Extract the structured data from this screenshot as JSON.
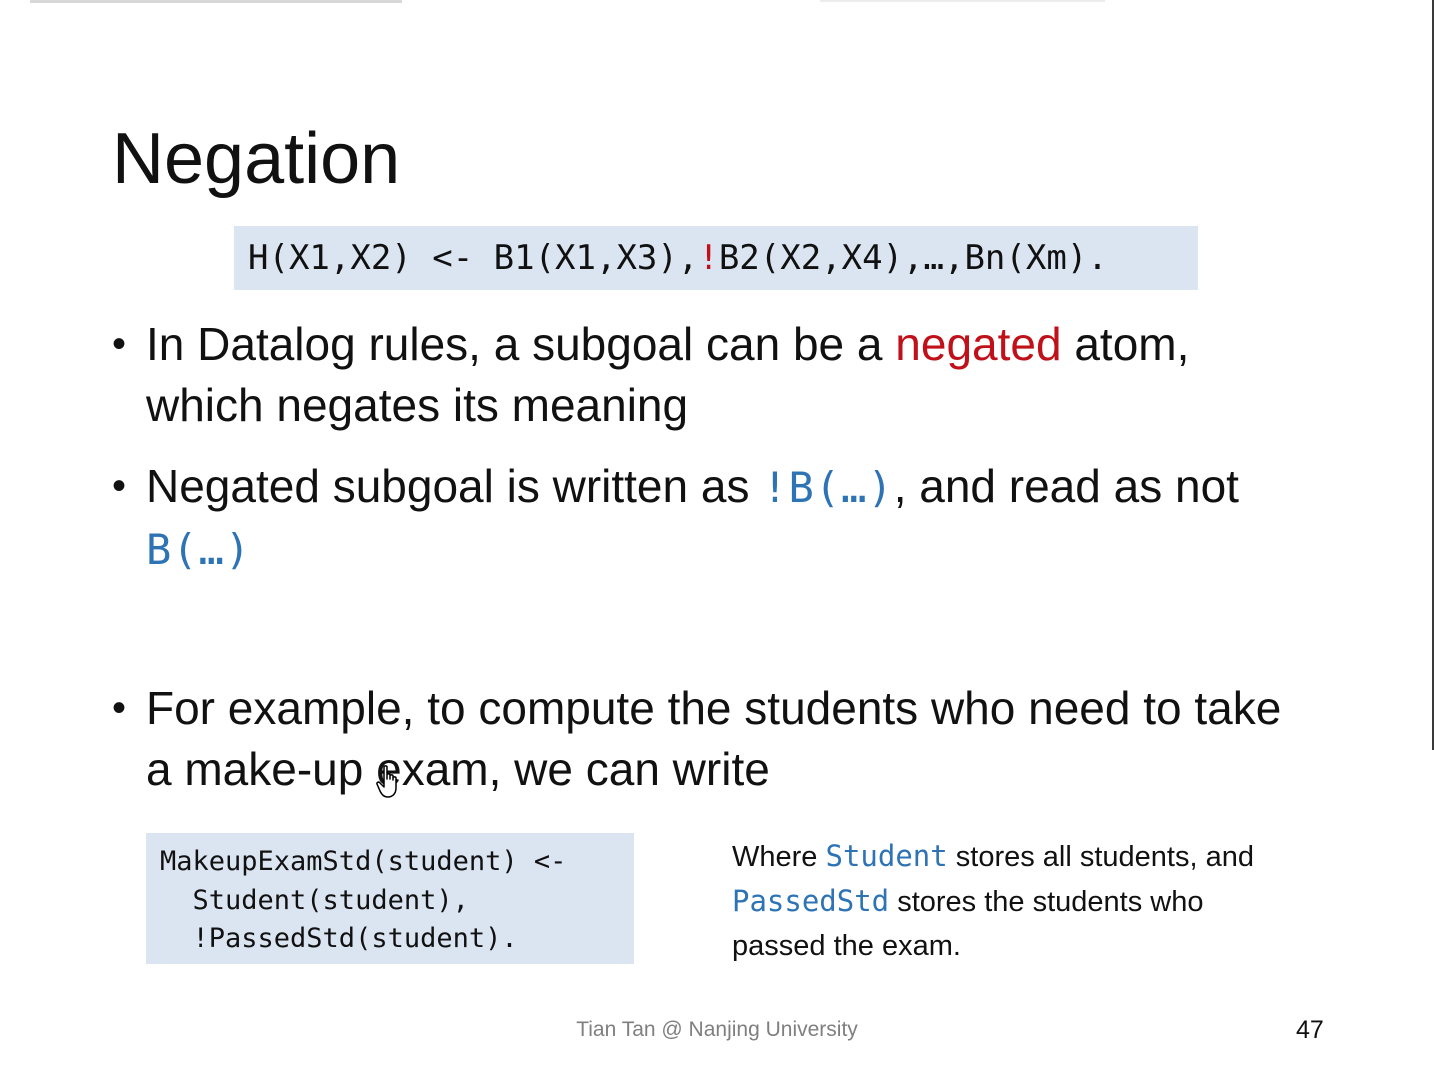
{
  "slide": {
    "title": "Negation",
    "rule_banner": {
      "before": "H(X1,X2) <- B1(X1,X3),",
      "negation": "!",
      "after": "B2(X2,X4),…,Bn(Xm)."
    },
    "bullets": [
      {
        "text_before": "In Datalog rules, a subgoal can be a ",
        "highlight": "negated",
        "text_after": " atom, which negates its meaning"
      },
      {
        "text_before": "Negated subgoal is written as ",
        "code1": "!B(…)",
        "text_mid": ", and read as not ",
        "code2": "B(…)"
      },
      {
        "text": "For example, to compute the students who need to take a make-up exam, we can write"
      }
    ],
    "code_example": {
      "line1": "MakeupExamStd(student) <-",
      "line2": "  Student(student),",
      "line3": "  !PassedStd(student)."
    },
    "note": {
      "t1": "Where ",
      "c1": "Student",
      "t2": " stores all students, and ",
      "c2": "PassedStd",
      "t3": " stores the students who passed the exam."
    },
    "footer": "Tian Tan @ Nanjing University",
    "page_number": "47"
  },
  "colors": {
    "code_background": "#dbe5f1",
    "negation_red": "#c0101a",
    "code_blue": "#2e74b5",
    "footer_gray": "#7f7f7f"
  },
  "icons": {
    "cursor": "hand-pointer-icon"
  }
}
